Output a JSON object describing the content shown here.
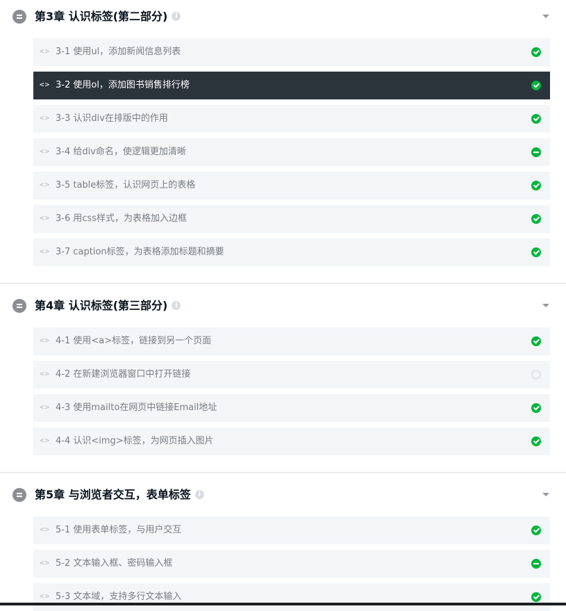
{
  "chapters": [
    {
      "title": "第3章 认识标签(第二部分)",
      "lessons": [
        {
          "label": "3-1 使用ul，添加新闻信息列表",
          "status": "done"
        },
        {
          "label": "3-2 使用ol，添加图书销售排行榜",
          "status": "done",
          "active": true
        },
        {
          "label": "3-3 认识div在排版中的作用",
          "status": "done"
        },
        {
          "label": "3-4 给div命名，使逻辑更加清晰",
          "status": "half"
        },
        {
          "label": "3-5 table标签，认识网页上的表格",
          "status": "done"
        },
        {
          "label": "3-6 用css样式，为表格加入边框",
          "status": "done"
        },
        {
          "label": "3-7 caption标签，为表格添加标题和摘要",
          "status": "done"
        }
      ]
    },
    {
      "title": "第4章 认识标签(第三部分)",
      "lessons": [
        {
          "label": "4-1 使用<a>标签，链接到另一个页面",
          "status": "done"
        },
        {
          "label": "4-2 在新建浏览器窗口中打开链接",
          "status": "none"
        },
        {
          "label": "4-3 使用mailto在网页中链接Email地址",
          "status": "done"
        },
        {
          "label": "4-4 认识<img>标签，为网页插入图片",
          "status": "done"
        }
      ]
    },
    {
      "title": "第5章 与浏览者交互，表单标签",
      "lessons": [
        {
          "label": "5-1 使用表单标签，与用户交互",
          "status": "done"
        },
        {
          "label": "5-2 文本输入框、密码输入框",
          "status": "half"
        },
        {
          "label": "5-3 文本域，支持多行文本输入",
          "status": "done"
        }
      ]
    }
  ],
  "icons": {
    "chapter": "list-icon",
    "info": "info-icon",
    "caret": "caret-down-icon",
    "lesson": "code-icon",
    "status_done": "check-circle-icon",
    "status_half": "half-complete-icon",
    "status_none": "empty-circle-icon"
  },
  "colors": {
    "accent_green": "#00b43c",
    "active_bg": "#2b333b",
    "lesson_bg": "#f3f5f7"
  }
}
